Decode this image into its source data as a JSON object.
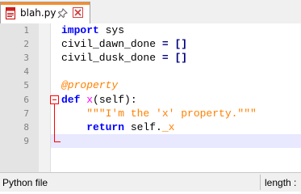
{
  "tab": {
    "title": "blah.py",
    "file_icon": "python-file-icon",
    "pin_icon": "pin-icon",
    "close_icon": "close-icon",
    "accent_color": "#fa8c28"
  },
  "editor": {
    "lines": [
      {
        "number": "1",
        "tokens": [
          {
            "t": "import",
            "c": "kw"
          },
          {
            "t": " sys",
            "c": "id"
          }
        ]
      },
      {
        "number": "2",
        "tokens": [
          {
            "t": "civil_dawn_done ",
            "c": "id"
          },
          {
            "t": "=",
            "c": "op"
          },
          {
            "t": " []",
            "c": "op"
          }
        ]
      },
      {
        "number": "3",
        "tokens": [
          {
            "t": "civil_dusk_done ",
            "c": "id"
          },
          {
            "t": "=",
            "c": "op"
          },
          {
            "t": " []",
            "c": "op"
          }
        ]
      },
      {
        "number": "4",
        "tokens": []
      },
      {
        "number": "5",
        "tokens": [
          {
            "t": "@property",
            "c": "dec"
          }
        ]
      },
      {
        "number": "6",
        "tokens": [
          {
            "t": "def",
            "c": "kw"
          },
          {
            "t": " ",
            "c": "id"
          },
          {
            "t": "x",
            "c": "fn"
          },
          {
            "t": "(self):",
            "c": "id"
          }
        ]
      },
      {
        "number": "7",
        "tokens": [
          {
            "t": "    \"\"\"I'm the 'x' property.\"\"\"",
            "c": "str"
          }
        ]
      },
      {
        "number": "8",
        "tokens": [
          {
            "t": "    ",
            "c": "id"
          },
          {
            "t": "return",
            "c": "kw"
          },
          {
            "t": " self.",
            "c": "id"
          },
          {
            "t": "_x",
            "c": "priv"
          }
        ]
      },
      {
        "number": "9",
        "tokens": []
      }
    ],
    "current_line": 9
  },
  "statusbar": {
    "file_type": "Python file",
    "length_label": "length : "
  }
}
